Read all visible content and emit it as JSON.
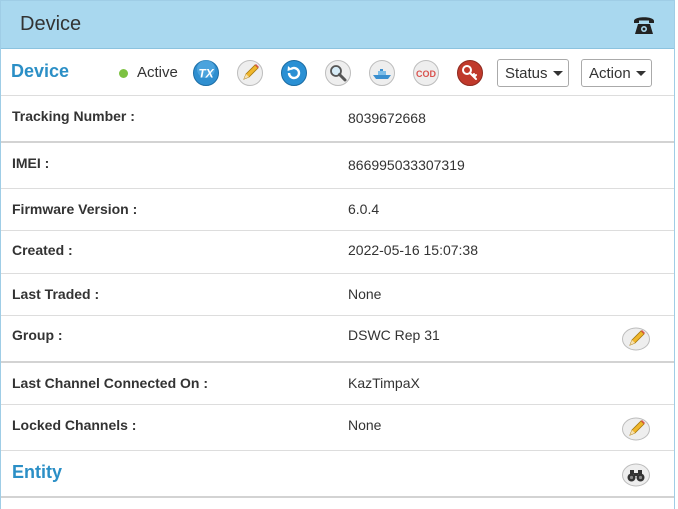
{
  "panel": {
    "title": "Device",
    "header_icon": "phone-icon"
  },
  "toolbar": {
    "section_title": "Device",
    "status_text": "Active",
    "status_color": "#7dc242",
    "icons": [
      "tx-icon",
      "pencil-icon",
      "refresh-icon",
      "magnifier-icon",
      "ship-icon",
      "cod-icon",
      "key-icon"
    ],
    "cod_label": "COD",
    "tx_label": "TX",
    "status_button": "Status",
    "action_button": "Action"
  },
  "rows": [
    {
      "label": "Tracking Number :",
      "value": "8039672668"
    },
    {
      "label": "IMEI :",
      "value": "866995033307319"
    },
    {
      "label": "Firmware Version :",
      "value": "6.0.4"
    },
    {
      "label": "Created :",
      "value": "2022-05-16 15:07:38"
    },
    {
      "label": "Last Traded :",
      "value": "None"
    },
    {
      "label": "Group :",
      "value": "DSWC Rep 31",
      "editable": true
    },
    {
      "label": "Last Channel Connected On :",
      "value": "KazTimpaX"
    },
    {
      "label": "Locked Channels :",
      "value": "None",
      "editable": true
    }
  ],
  "entity": {
    "title": "Entity",
    "icon": "binoculars-icon"
  },
  "colors": {
    "header_bg": "#a9d8ef",
    "accent_blue": "#2b8fc6"
  }
}
